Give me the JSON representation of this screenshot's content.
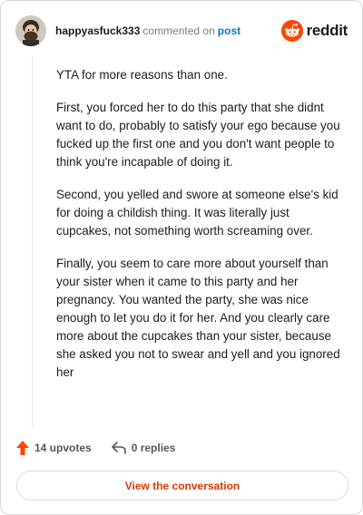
{
  "comment": {
    "username": "happyasfuck333",
    "commented_text": "commented on",
    "post_link_label": "post",
    "brand_name": "reddit",
    "paragraphs": [
      "YTA for more reasons than one.",
      "First, you forced her to do this party that she didnt want to do, probably to satisfy your ego because you fucked up the first one and you don't want people to think you're incapable of doing it.",
      "Second, you yelled and swore at someone else's kid for doing a childish thing. It was literally just cupcakes, not something worth screaming over.",
      "Finally, you seem to care more about yourself than your sister when it came to this party and her pregnancy. You wanted the party, she was nice enough to let you do it for her. And you clearly care more about the cupcakes than your sister, because she asked you not to swear and yell and you ignored her"
    ]
  },
  "actions": {
    "upvotes_label": "14 upvotes",
    "replies_label": "0 replies",
    "upvote_icon": "upvote-arrow-icon",
    "reply_icon": "reply-arrow-icon"
  },
  "cta": {
    "label": "View the conversation"
  },
  "colors": {
    "reddit_orange": "#ff4500",
    "link_blue": "#0079d3",
    "cta_text": "#d93a00"
  }
}
